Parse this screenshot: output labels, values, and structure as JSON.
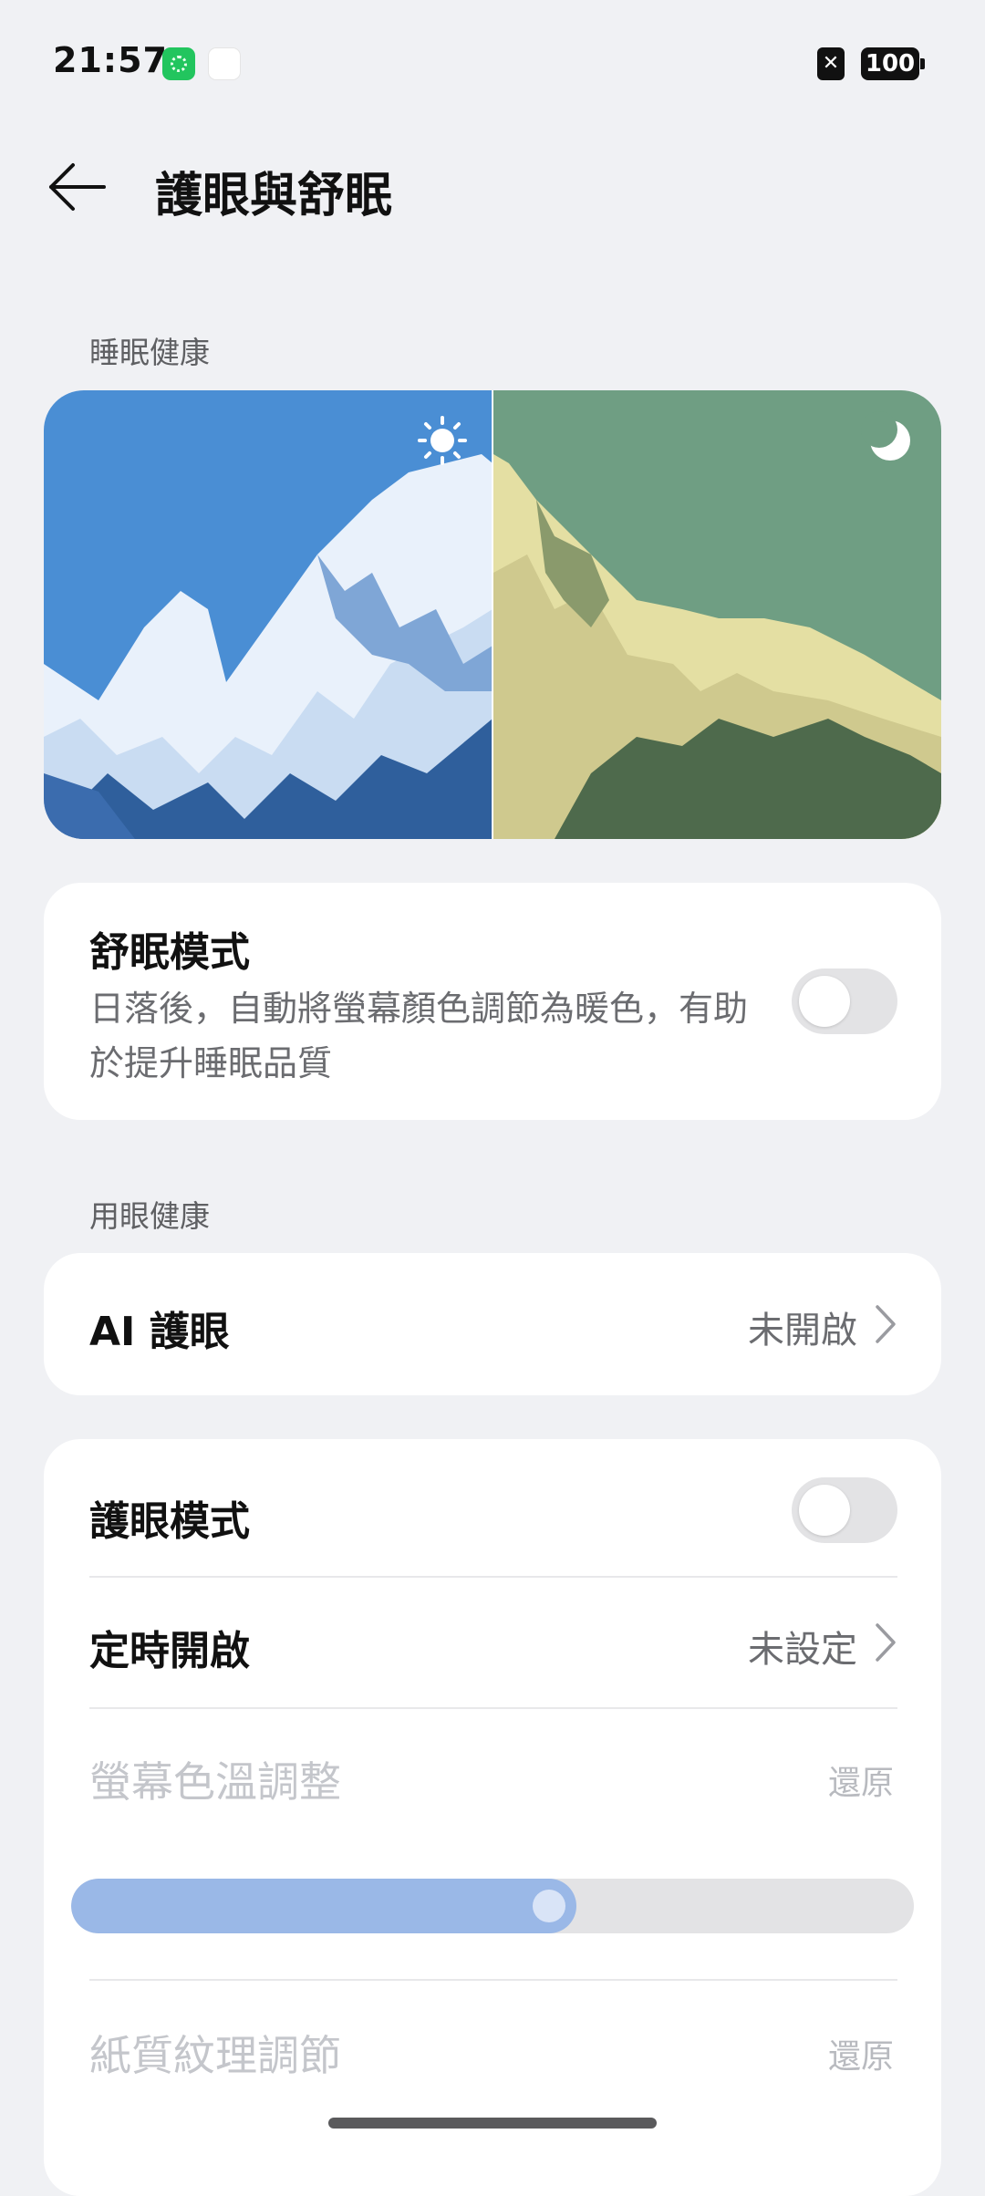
{
  "status_bar": {
    "time": "21:57",
    "battery": "100",
    "sim_icon": "sim-x-icon"
  },
  "header": {
    "title": "護眼與舒眠",
    "back_icon": "arrow-left-icon"
  },
  "sleep_section": {
    "label": "睡眠健康",
    "hero": {
      "day_icon": "sun-icon",
      "night_icon": "moon-icon"
    },
    "sleep_mode": {
      "title": "舒眠模式",
      "description": "日落後，自動將螢幕顏色調節為暖色，有助於提升睡眠品質",
      "enabled": false
    }
  },
  "eye_section": {
    "label": "用眼健康",
    "ai_eye": {
      "title": "AI 護眼",
      "value": "未開啟"
    },
    "eye_mode": {
      "title": "護眼模式",
      "enabled": false
    },
    "schedule": {
      "title": "定時開啟",
      "value": "未設定"
    },
    "color_temp": {
      "title": "螢幕色溫調整",
      "reset": "還原",
      "level": 0.6
    },
    "paper_texture": {
      "title": "紙質紋理調節",
      "reset": "還原"
    }
  },
  "colors": {
    "background": "#f0f1f4",
    "card": "#ffffff",
    "slider_fill": "#9ab8e7",
    "toggle_off": "#e3e3e5"
  }
}
